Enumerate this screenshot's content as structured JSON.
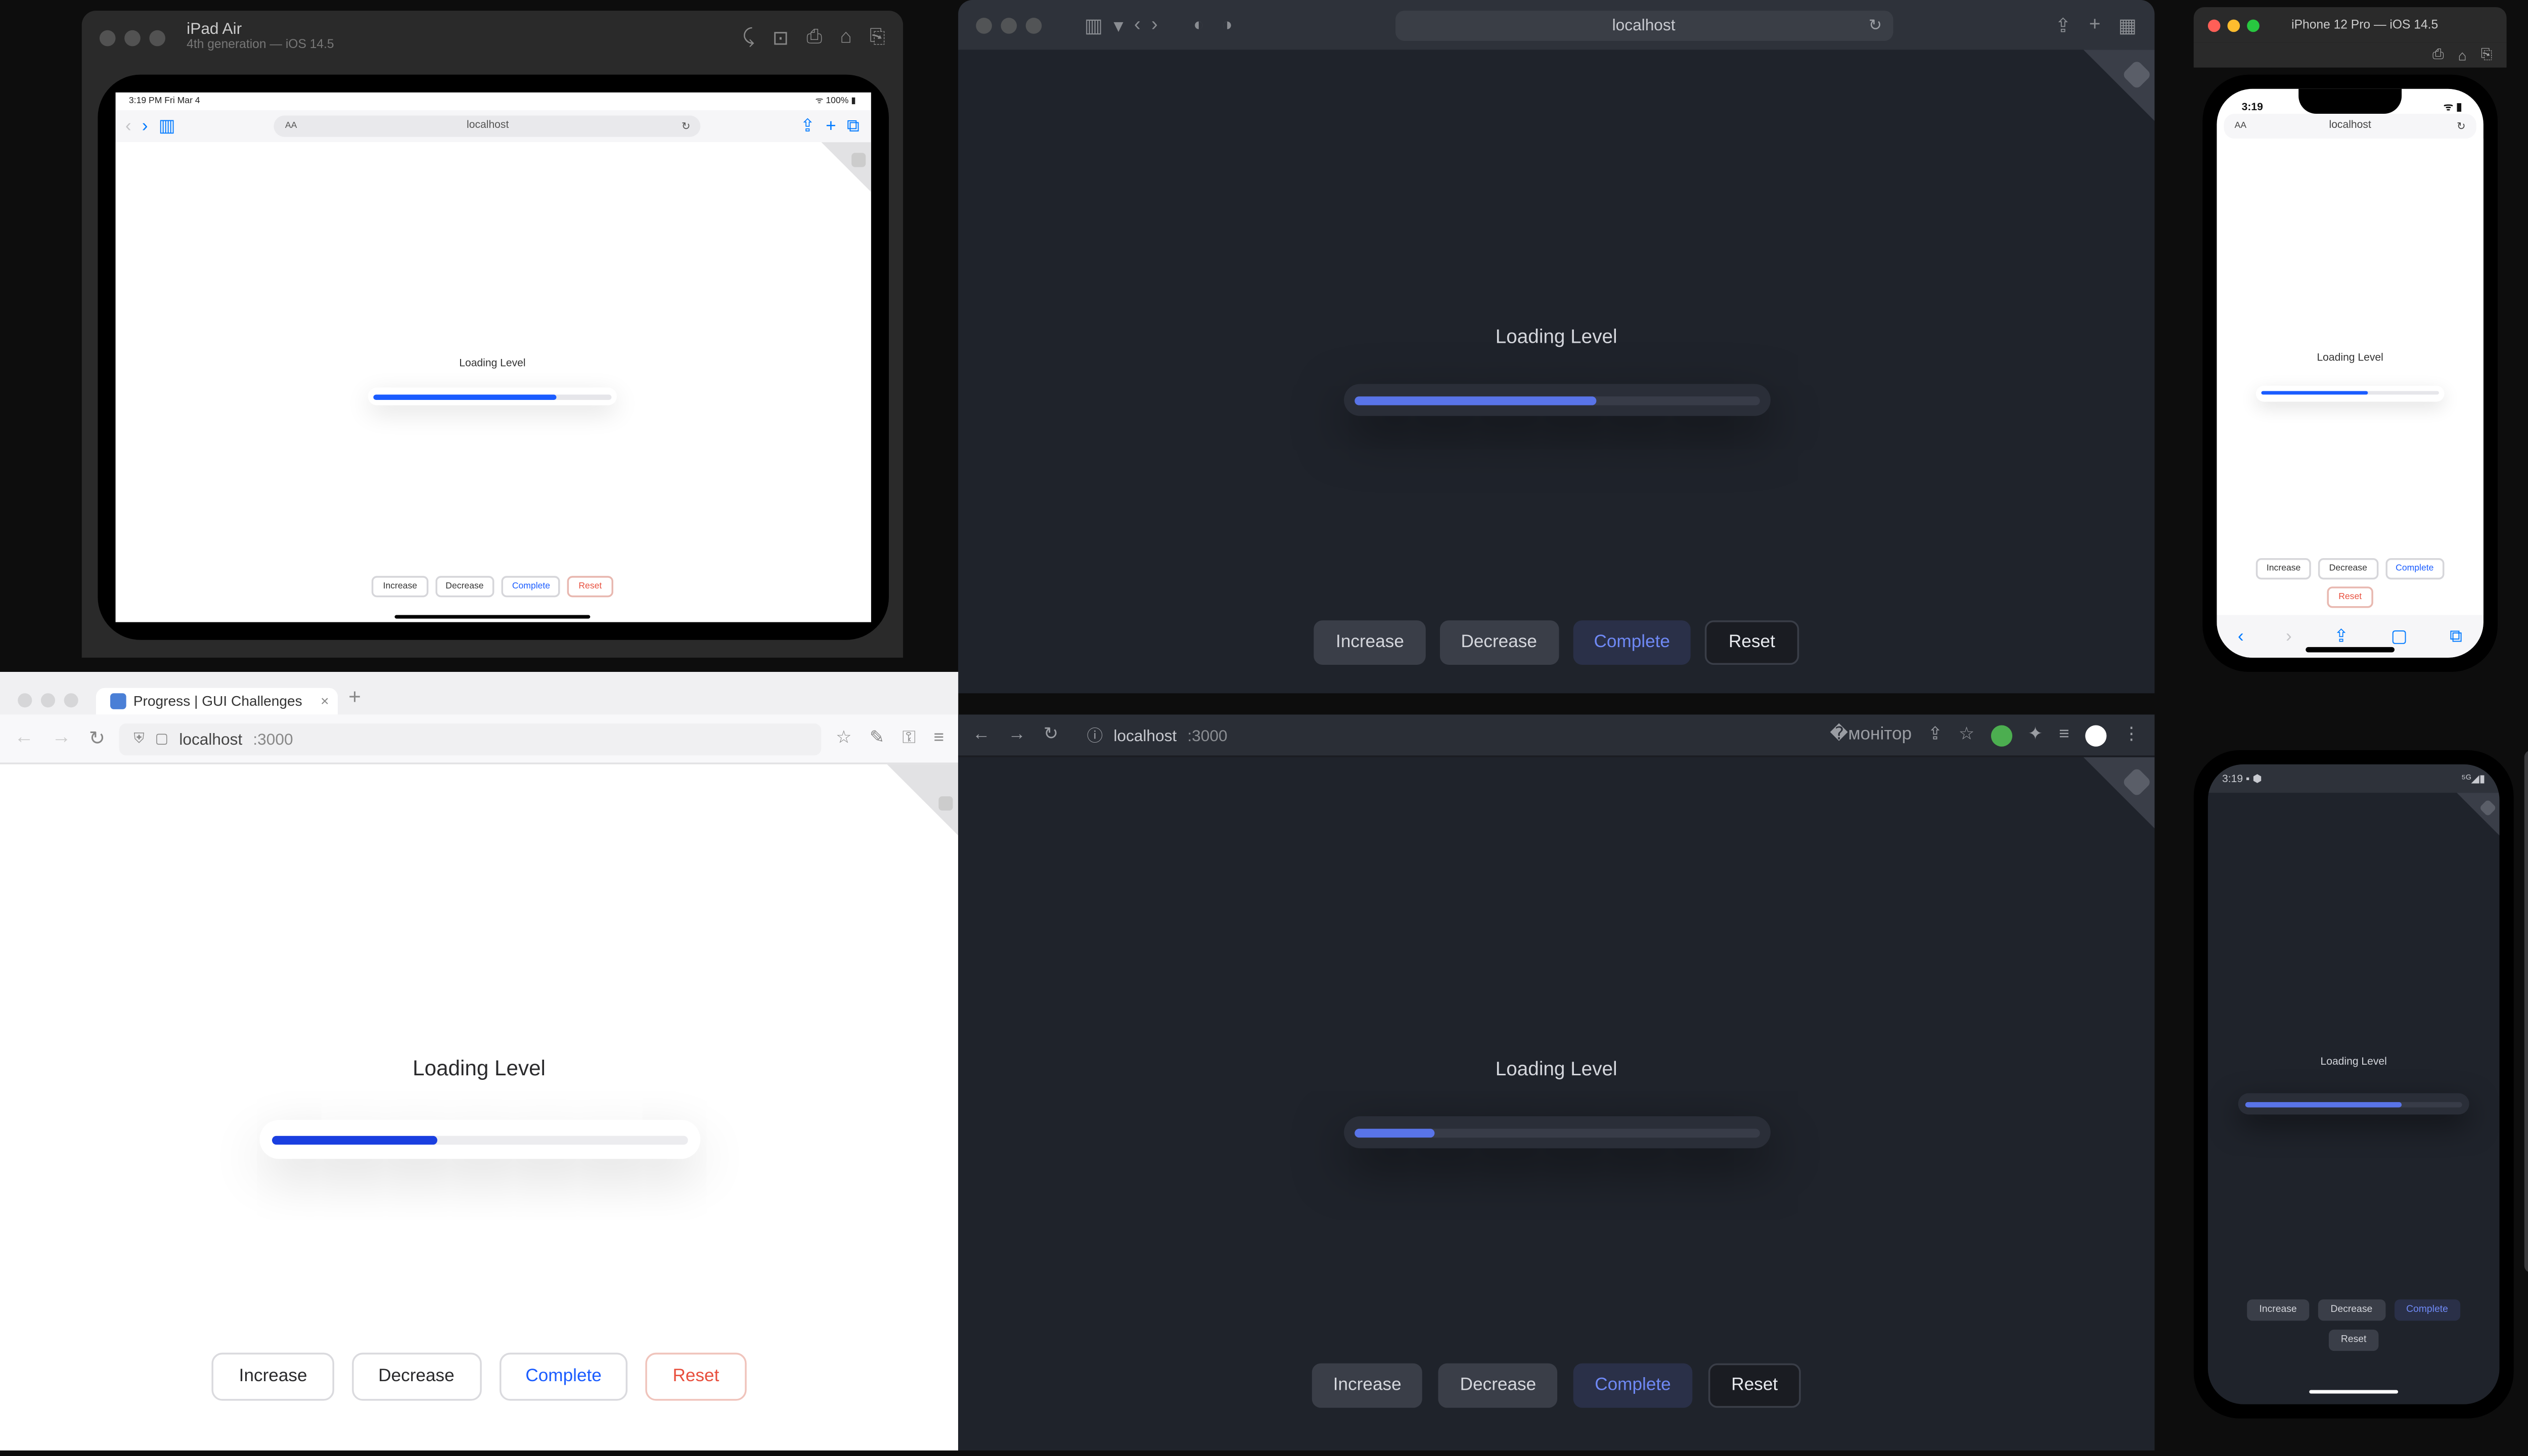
{
  "app_label": "Loading Level",
  "buttons": {
    "increase": "Increase",
    "decrease": "Decrease",
    "complete": "Complete",
    "reset": "Reset"
  },
  "ipad_sim": {
    "title": "iPad Air",
    "subtitle": "4th generation — iOS 14.5",
    "status_time": "3:19 PM  Fri Mar 4",
    "status_right": "ᯤ 100% ▮",
    "address": "localhost",
    "aa": "AA",
    "progress_pct": 77
  },
  "safari": {
    "address": "localhost",
    "progress_pct": 60
  },
  "iphone_sim": {
    "title": "iPhone 12 Pro — iOS 14.5",
    "status_time": "3:19",
    "status_right": "ᯤ ▮",
    "address": "localhost",
    "aa": "AA",
    "progress_pct": 60
  },
  "firefox": {
    "tab_title": "Progress | GUI Challenges",
    "address_host": "localhost",
    "address_port": ":3000",
    "progress_pct": 40
  },
  "chrome": {
    "address_host": "localhost",
    "address_port": ":3000",
    "progress_pct": 20
  },
  "android": {
    "status_time": "3:19",
    "status_debug": "▪",
    "status_right": "⁵ᴳ◢▮",
    "progress_pct": 72
  }
}
